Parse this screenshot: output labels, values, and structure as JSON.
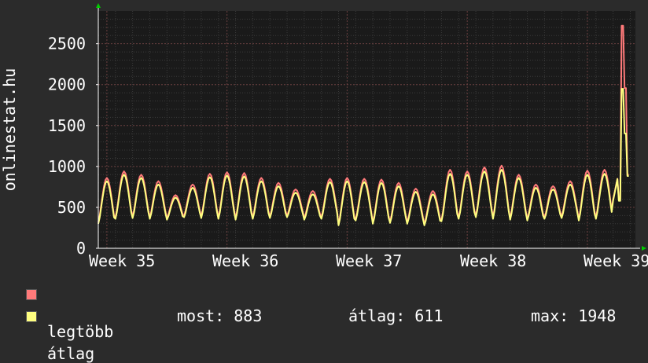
{
  "chart_data": {
    "type": "line",
    "ylabel": "onlinestat.hu",
    "xlabel": "",
    "title": "",
    "ylim": [
      0,
      2900
    ],
    "yticks": [
      0,
      500,
      1000,
      1500,
      2000,
      2500
    ],
    "xticks": [
      "Week 35",
      "Week 36",
      "Week 37",
      "Week 38",
      "Week 39"
    ],
    "grid": true,
    "series": [
      {
        "name": "legtöbb",
        "color": "#ff7a7a",
        "daily": [
          {
            "min": 320,
            "max": 860
          },
          {
            "min": 380,
            "max": 940
          },
          {
            "min": 390,
            "max": 900
          },
          {
            "min": 380,
            "max": 820
          },
          {
            "min": 370,
            "max": 650
          },
          {
            "min": 400,
            "max": 780
          },
          {
            "min": 390,
            "max": 910
          },
          {
            "min": 380,
            "max": 930
          },
          {
            "min": 370,
            "max": 920
          },
          {
            "min": 380,
            "max": 860
          },
          {
            "min": 390,
            "max": 800
          },
          {
            "min": 400,
            "max": 720
          },
          {
            "min": 370,
            "max": 700
          },
          {
            "min": 380,
            "max": 850
          },
          {
            "min": 300,
            "max": 860
          },
          {
            "min": 360,
            "max": 850
          },
          {
            "min": 320,
            "max": 840
          },
          {
            "min": 330,
            "max": 800
          },
          {
            "min": 320,
            "max": 730
          },
          {
            "min": 300,
            "max": 700
          },
          {
            "min": 350,
            "max": 960
          },
          {
            "min": 380,
            "max": 940
          },
          {
            "min": 400,
            "max": 990
          },
          {
            "min": 380,
            "max": 1010
          },
          {
            "min": 370,
            "max": 900
          },
          {
            "min": 360,
            "max": 780
          },
          {
            "min": 380,
            "max": 760
          },
          {
            "min": 390,
            "max": 820
          },
          {
            "min": 360,
            "max": 950
          },
          {
            "min": 380,
            "max": 960
          },
          {
            "min": 600,
            "max": 2720
          }
        ]
      },
      {
        "name": "átlag",
        "color": "#ffff80",
        "daily": [
          {
            "min": 300,
            "max": 820
          },
          {
            "min": 360,
            "max": 900
          },
          {
            "min": 370,
            "max": 860
          },
          {
            "min": 360,
            "max": 780
          },
          {
            "min": 350,
            "max": 620
          },
          {
            "min": 380,
            "max": 740
          },
          {
            "min": 370,
            "max": 870
          },
          {
            "min": 360,
            "max": 890
          },
          {
            "min": 350,
            "max": 880
          },
          {
            "min": 360,
            "max": 820
          },
          {
            "min": 370,
            "max": 760
          },
          {
            "min": 380,
            "max": 680
          },
          {
            "min": 350,
            "max": 660
          },
          {
            "min": 360,
            "max": 810
          },
          {
            "min": 280,
            "max": 820
          },
          {
            "min": 340,
            "max": 810
          },
          {
            "min": 300,
            "max": 800
          },
          {
            "min": 310,
            "max": 760
          },
          {
            "min": 300,
            "max": 690
          },
          {
            "min": 280,
            "max": 660
          },
          {
            "min": 330,
            "max": 910
          },
          {
            "min": 360,
            "max": 900
          },
          {
            "min": 380,
            "max": 940
          },
          {
            "min": 360,
            "max": 960
          },
          {
            "min": 350,
            "max": 860
          },
          {
            "min": 340,
            "max": 740
          },
          {
            "min": 360,
            "max": 720
          },
          {
            "min": 370,
            "max": 780
          },
          {
            "min": 340,
            "max": 900
          },
          {
            "min": 360,
            "max": 910
          },
          {
            "min": 580,
            "max": 1948
          }
        ]
      }
    ]
  },
  "legend": {
    "items": [
      {
        "label": "legtöbb",
        "color": "#ff7a7a"
      },
      {
        "label": "átlag",
        "color": "#ffff80"
      }
    ]
  },
  "stats": {
    "now": "most: 883",
    "avg": "átlag: 611",
    "max": "max: 1948"
  }
}
